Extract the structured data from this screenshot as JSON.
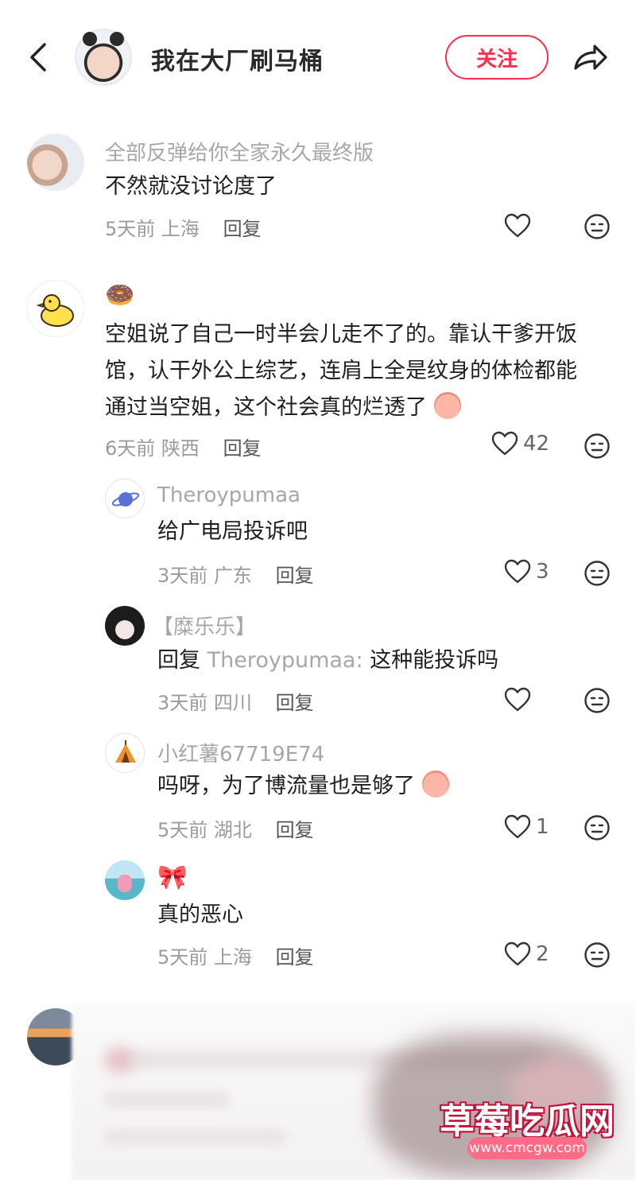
{
  "header": {
    "title": "我在大厂刷马桶",
    "follow_label": "关注"
  },
  "comments": [
    {
      "user": "全部反弹给你全家永久最终版",
      "text": "不然就没讨论度了",
      "time": "5天前",
      "location": "上海",
      "reply_label": "回复",
      "likes": ""
    },
    {
      "user": "🍩",
      "lines": [
        "空姐说了自己一时半会儿走不了的。靠认干爹开饭",
        "馆，认干外公上综艺，连肩上全是纹身的体检都能",
        "通过当空姐，这个社会真的烂透了"
      ],
      "time": "6天前",
      "location": "陕西",
      "reply_label": "回复",
      "likes": "42",
      "replies": [
        {
          "user": "Theroypumaa",
          "text": "给广电局投诉吧",
          "time": "3天前",
          "location": "广东",
          "reply_label": "回复",
          "likes": "3"
        },
        {
          "user": "【糜乐乐】",
          "reply_prefix": "回复",
          "mention": "Theroypumaa:",
          "text": "这种能投诉吗",
          "time": "3天前",
          "location": "四川",
          "reply_label": "回复",
          "likes": ""
        },
        {
          "user": "小红薯67719E74",
          "text": "吗呀，为了博流量也是够了",
          "time": "5天前",
          "location": "湖北",
          "reply_label": "回复",
          "likes": "1"
        },
        {
          "user": "🎀",
          "text": "真的恶心",
          "time": "5天前",
          "location": "上海",
          "reply_label": "回复",
          "likes": "2"
        }
      ]
    }
  ],
  "watermark": {
    "text": "草莓吃瓜网",
    "url": "www.cmcgw.com"
  },
  "colors": {
    "accent": "#ff2e4d",
    "muted": "#a7a7ab",
    "text": "#1f1f1f"
  },
  "icons": [
    "back-arrow-icon",
    "share-icon",
    "heart-icon",
    "emoji-face-icon"
  ]
}
